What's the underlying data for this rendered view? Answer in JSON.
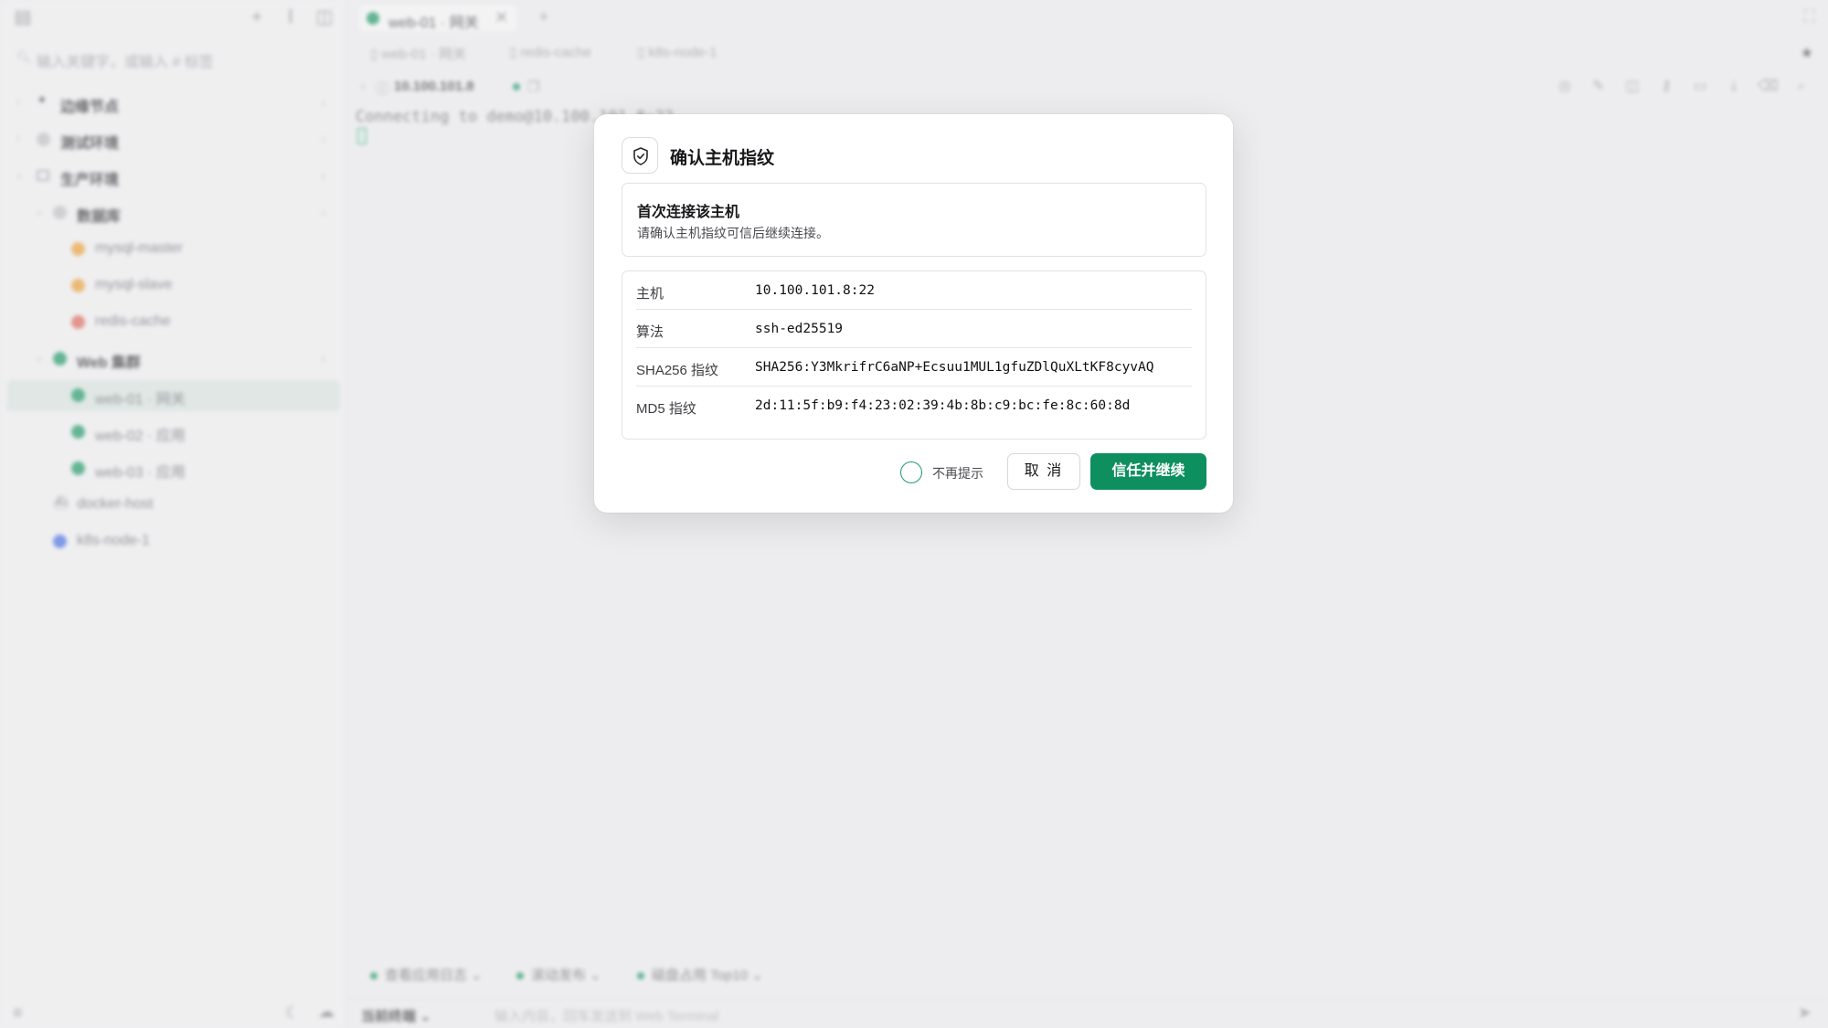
{
  "sidebar": {
    "search_placeholder": "输入关键字，或输入 # 标签",
    "tree": [
      {
        "label": "边缘节点",
        "color": "#444448"
      },
      {
        "label": "测试环境",
        "color": "#9a9aa0"
      },
      {
        "label": "生产环境",
        "color": "#9a9aa0"
      },
      {
        "label": "数据库",
        "color": "#9a9aa0"
      },
      {
        "label": "mysql-master",
        "color": "#f0a43a"
      },
      {
        "label": "mysql-slave",
        "color": "#f0a43a"
      },
      {
        "label": "redis-cache",
        "color": "#e36a5c"
      },
      {
        "label": "Web 集群",
        "color": "#1f9c68"
      },
      {
        "label": "web-01 · 网关",
        "color": "#1f9c68"
      },
      {
        "label": "web-02 · 应用",
        "color": "#1f9c68"
      },
      {
        "label": "web-03 · 应用",
        "color": "#1f9c68"
      },
      {
        "label": "docker-host",
        "color": "#6a6a70"
      },
      {
        "label": "k8s-node-1",
        "color": "#4a72e8"
      }
    ]
  },
  "tabs": [
    {
      "label": "web-01 · 网关",
      "close": "✕"
    }
  ],
  "breadcrumbs": [
    "web-01 · 网关",
    "redis-cache",
    "k8s-node-1"
  ],
  "host": {
    "ip": "10.100.101.8"
  },
  "terminal": {
    "line": "Connecting to demo@10.100.101.8:22"
  },
  "quick_commands": [
    "查看应用日志",
    "滚动发布",
    "磁盘占用 Top10"
  ],
  "command_bar": {
    "target": "当前终端",
    "placeholder": "输入内容，回车发送到 Web Terminal"
  },
  "dialog": {
    "title": "确认主机指纹",
    "warning_title": "首次连接该主机",
    "warning_desc": "请确认主机指纹可信后继续连接。",
    "rows": [
      {
        "key": "主机",
        "value": "10.100.101.8:22"
      },
      {
        "key": "算法",
        "value": "ssh-ed25519"
      },
      {
        "key": "SHA256 指纹",
        "value": "SHA256:Y3MkrifrC6aNP+Ecsuu1MUL1gfuZDlQuXLtKF8cyvAQ"
      },
      {
        "key": "MD5 指纹",
        "value": "2d:11:5f:b9:f4:23:02:39:4b:8b:c9:bc:fe:8c:60:8d"
      }
    ],
    "dont_ask_label": "不再提示",
    "cancel_label": "取 消",
    "trust_label": "信任并继续"
  },
  "colors": {
    "accent": "#0e8f5f",
    "online": "#1f9c68"
  }
}
